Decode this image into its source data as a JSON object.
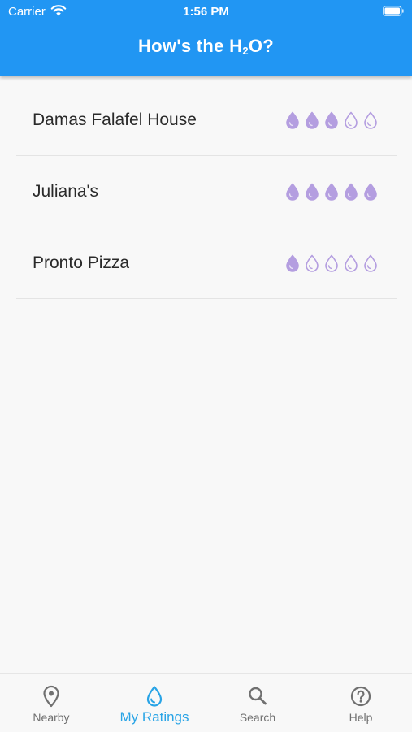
{
  "status_bar": {
    "carrier": "Carrier",
    "time": "1:56 PM"
  },
  "header": {
    "title_prefix": "How's the H",
    "title_sub": "2",
    "title_suffix": "O?",
    "color": "#2196f3"
  },
  "ratings": [
    {
      "name": "Damas Falafel House",
      "rating": 3,
      "max": 5
    },
    {
      "name": "Juliana's",
      "rating": 5,
      "max": 5
    },
    {
      "name": "Pronto Pizza",
      "rating": 1,
      "max": 5
    }
  ],
  "rating_color": "#b49ee0",
  "tabs": [
    {
      "label": "Nearby",
      "icon": "location-pin-icon"
    },
    {
      "label": "My Ratings",
      "icon": "water-drop-icon",
      "active": true
    },
    {
      "label": "Search",
      "icon": "search-icon"
    },
    {
      "label": "Help",
      "icon": "help-circle-icon"
    }
  ],
  "active_tab_color": "#29a4e6"
}
